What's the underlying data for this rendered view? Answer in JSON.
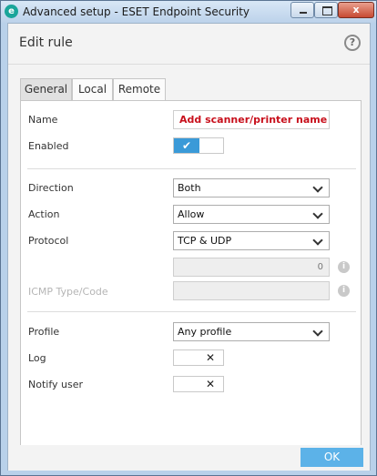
{
  "window": {
    "title": "Advanced setup - ESET Endpoint Security",
    "app_icon_glyph": "e"
  },
  "titlebar_buttons": {
    "close_glyph": "x"
  },
  "dialog": {
    "title": "Edit rule",
    "help_glyph": "?"
  },
  "tabs": [
    {
      "label": "General",
      "active": true
    },
    {
      "label": "Local",
      "active": false
    },
    {
      "label": "Remote",
      "active": false
    }
  ],
  "fields": {
    "name": {
      "label": "Name",
      "value": "Add scanner/printer name"
    },
    "enabled": {
      "label": "Enabled",
      "state": "on",
      "on_glyph": "✔"
    },
    "direction": {
      "label": "Direction",
      "value": "Both"
    },
    "action": {
      "label": "Action",
      "value": "Allow"
    },
    "protocol": {
      "label": "Protocol",
      "value": "TCP & UDP"
    },
    "protocol_number": {
      "value": "0",
      "info_glyph": "i"
    },
    "icmp": {
      "label": "ICMP Type/Code",
      "value": "",
      "info_glyph": "i"
    },
    "profile": {
      "label": "Profile",
      "value": "Any profile"
    },
    "log": {
      "label": "Log",
      "state": "off",
      "off_glyph": "✕"
    },
    "notify": {
      "label": "Notify user",
      "state": "off",
      "off_glyph": "✕"
    }
  },
  "footer": {
    "ok_label": "OK"
  },
  "colors": {
    "accent": "#3a9ad8",
    "ok_button": "#5cb2e8",
    "name_text": "#c8101c"
  },
  "icons": [
    "eset-app-icon",
    "minimize-icon",
    "maximize-icon",
    "close-icon",
    "help-icon",
    "chevron-down-icon",
    "info-icon",
    "checkmark-icon",
    "x-icon"
  ]
}
